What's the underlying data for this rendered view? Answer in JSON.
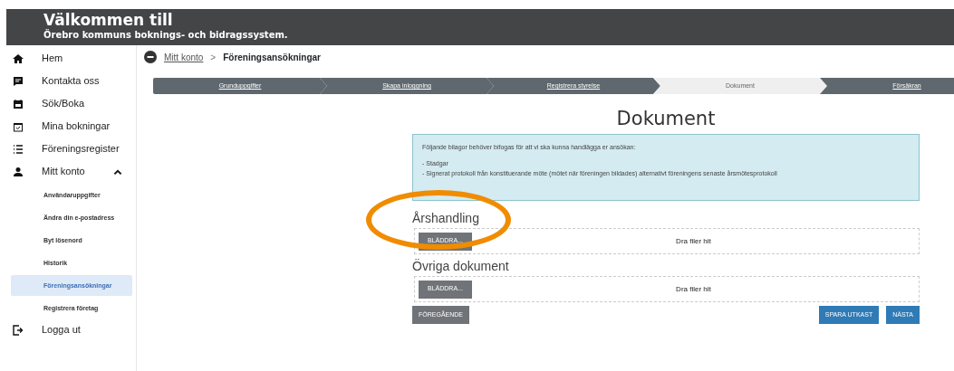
{
  "header": {
    "title": "Välkommen till",
    "subtitle": "Örebro kommuns boknings- och bidragssystem."
  },
  "sidebar": {
    "items": [
      {
        "label": "Hem",
        "selected": false
      },
      {
        "label": "Kontakta oss",
        "selected": false
      },
      {
        "label": "Sök/Boka",
        "selected": false
      },
      {
        "label": "Mina bokningar",
        "selected": false
      },
      {
        "label": "Föreningsregister",
        "selected": false
      },
      {
        "label": "Mitt konto",
        "selected": false,
        "expanded": true,
        "children": [
          {
            "label": "Användaruppgifter",
            "selected": false
          },
          {
            "label": "Ändra din e-postadress",
            "selected": false
          },
          {
            "label": "Byt lösenord",
            "selected": false
          },
          {
            "label": "Historik",
            "selected": false
          },
          {
            "label": "Föreningsansökningar",
            "selected": true
          },
          {
            "label": "Registrera företag",
            "selected": false
          }
        ]
      },
      {
        "label": "Logga ut",
        "selected": false
      }
    ]
  },
  "breadcrumb": [
    {
      "label": "Mitt konto",
      "kind": "link"
    },
    {
      "label": ">",
      "kind": "separator"
    },
    {
      "label": "Föreningsansökningar",
      "kind": "current"
    }
  ],
  "steps": [
    {
      "label": "Grunduppgifter",
      "selected": false
    },
    {
      "label": "Skapa inloggning",
      "selected": false
    },
    {
      "label": "Registrera styrelse",
      "selected": false
    },
    {
      "label": "Dokument",
      "selected": true
    },
    {
      "label": "Försäkran",
      "selected": false
    }
  ],
  "page_title": "Dokument",
  "info": {
    "intro": "Följande bilagor behöver bifogas för att vi ska kunna handlägga er ansökan:",
    "items": [
      "- Stadgar",
      "- Signerat protokoll från konstituerande möte (mötet när föreningen bildades) alternativt föreningens senaste årsmötesprotokoll"
    ]
  },
  "uploads": [
    {
      "heading": "Årshandling",
      "button": "BLÄDDRA...",
      "drop_text": "Dra filer hit"
    },
    {
      "heading": "Övriga dokument",
      "button": "BLÄDDRA...",
      "drop_text": "Dra filer hit"
    }
  ],
  "buttons": {
    "previous": "FÖREGÅENDE",
    "save": "SPARA UTKAST",
    "next": "NÄSTA"
  },
  "annotation": {
    "kind": "circle",
    "color": "#f08c00"
  }
}
